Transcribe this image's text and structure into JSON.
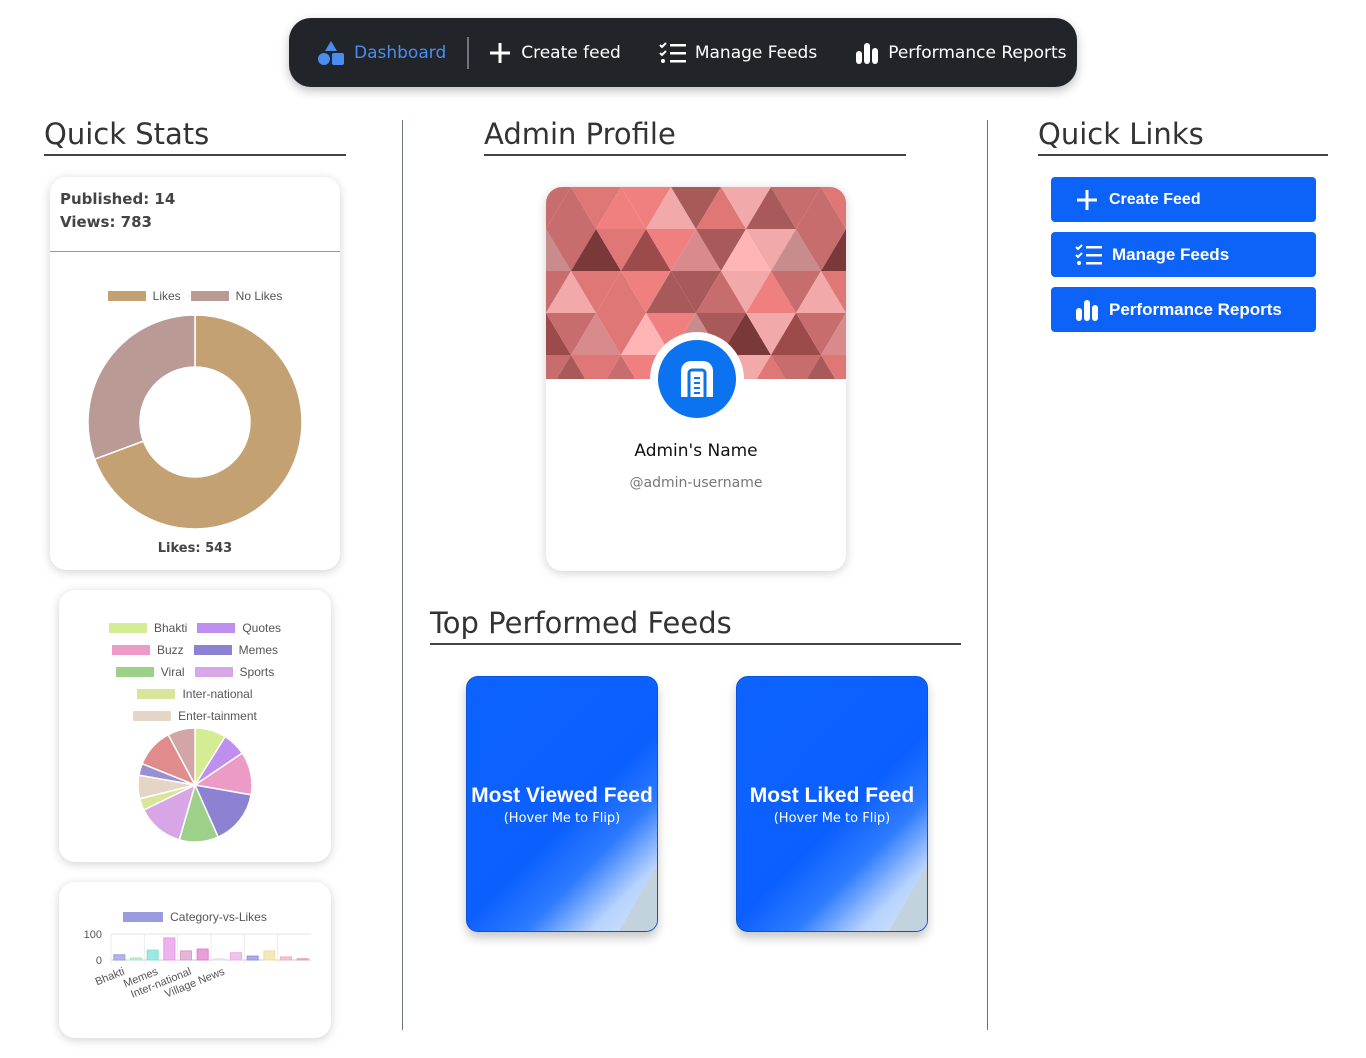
{
  "nav": {
    "items": [
      {
        "label": "Dashboard",
        "icon": "shapes-icon",
        "active": true
      },
      {
        "label": "Create feed",
        "icon": "plus-icon"
      },
      {
        "label": "Manage Feeds",
        "icon": "checklist-icon"
      },
      {
        "label": "Performance Reports",
        "icon": "bar-chart-icon"
      }
    ]
  },
  "quick_stats": {
    "heading": "Quick Stats",
    "published": "Published: 14",
    "views": "Views: 783",
    "likes_caption": "Likes: 543"
  },
  "admin_profile": {
    "heading": "Admin Profile",
    "name": "Admin's Name",
    "username": "@admin-username",
    "avatar_icon": "n-logo-icon"
  },
  "top_feeds": {
    "heading": "Top Performed Feeds",
    "cards": [
      {
        "title": "Most Viewed Feed",
        "hint": "(Hover Me to Flip)"
      },
      {
        "title": "Most Liked Feed",
        "hint": "(Hover Me to Flip)"
      }
    ]
  },
  "quick_links": {
    "heading": "Quick Links",
    "buttons": [
      {
        "label": "Create Feed",
        "icon": "plus-icon"
      },
      {
        "label": "Manage Feeds",
        "icon": "checklist-icon"
      },
      {
        "label": "Performance Reports",
        "icon": "bar-chart-icon"
      }
    ]
  },
  "colors": {
    "accent": "#0d63f8",
    "nav_bg": "#212529",
    "nav_active": "#4a8cf0"
  },
  "chart_data": [
    {
      "type": "pie",
      "variant": "doughnut",
      "labels": [
        "Likes",
        "No Likes"
      ],
      "values": [
        543,
        240
      ],
      "colors": [
        "#c4a173",
        "#b99a95"
      ],
      "legend_position": "top"
    },
    {
      "type": "pie",
      "labels": [
        "Bhakti",
        "Quotes",
        "Buzz",
        "Memes",
        "Viral",
        "Sports",
        "Inter-national",
        "Enter-tainment"
      ],
      "legend_colors": [
        "#d4ec94",
        "#bf8ff0",
        "#ec9ac6",
        "#8d82d2",
        "#9dd18a",
        "#d8a6e6",
        "#d9e59a",
        "#e3d6c6"
      ],
      "values": [
        8,
        6,
        11,
        14,
        10,
        12,
        3,
        6,
        3,
        10,
        7
      ],
      "slice_colors": [
        "#d4ec94",
        "#bf8ff0",
        "#ec9ac6",
        "#8d82d2",
        "#9dd18a",
        "#d8a6e6",
        "#d9e59a",
        "#e3d6c6",
        "#9a8fd0",
        "#e08c8c",
        "#d2a6a6"
      ],
      "legend_position": "top"
    },
    {
      "type": "bar",
      "series": [
        {
          "name": "Category-vs-Likes"
        }
      ],
      "categories": [
        "Bhakti",
        "",
        "Memes",
        "",
        "Inter-national",
        "",
        "Village News",
        "",
        "",
        "",
        "",
        ""
      ],
      "values": [
        20,
        8,
        38,
        85,
        35,
        42,
        5,
        28,
        15,
        35,
        12,
        5
      ],
      "bar_colors": [
        "#9b9be0",
        "#a8e8c8",
        "#7ee0d8",
        "#e89ae8",
        "#d8a0c8",
        "#e080d0",
        "#e0e0f0",
        "#e8b0e8",
        "#9090e0",
        "#f0e0a0",
        "#f0b0c0",
        "#e0a0c0"
      ],
      "ylim": [
        0,
        100
      ],
      "yticks": [
        "100",
        "0"
      ],
      "legend_position": "top"
    }
  ]
}
